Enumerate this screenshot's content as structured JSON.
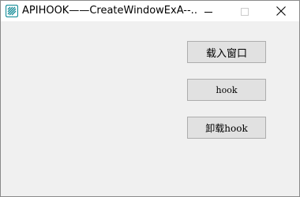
{
  "window": {
    "title": "APIHOOK——CreateWindowExA--..."
  },
  "icons": {
    "app": "app-icon",
    "minimize": "minimize-icon",
    "maximize": "maximize-icon",
    "close": "close-icon"
  },
  "buttons": {
    "load_window": "载入窗口",
    "hook": "hook",
    "unload_hook": "卸载hook"
  },
  "colors": {
    "client_bg": "#f0f0f0",
    "button_bg": "#e1e1e1",
    "button_border": "#adadad",
    "icon_teal": "#1a8f9a"
  }
}
